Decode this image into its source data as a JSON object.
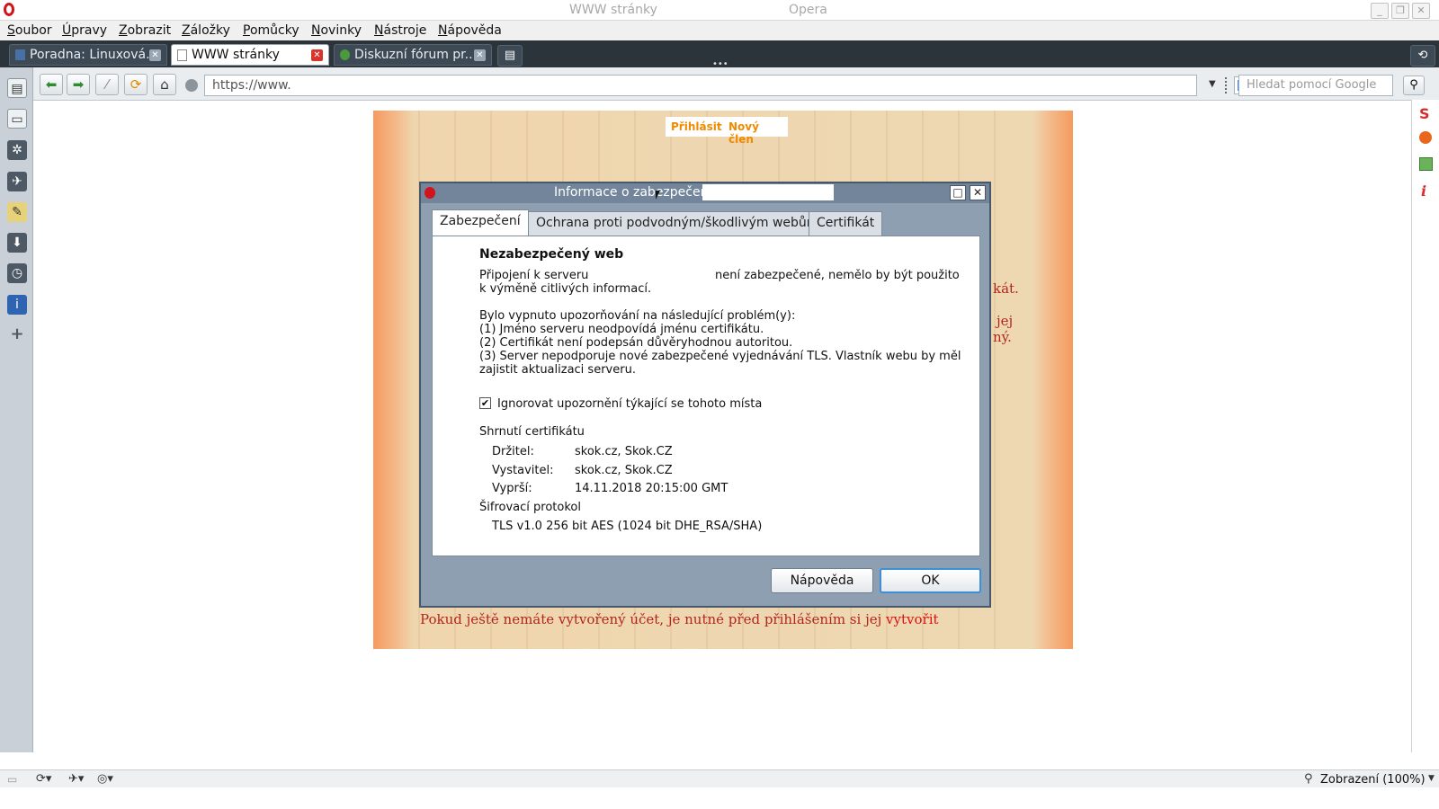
{
  "window": {
    "title_left": "WWW stránky",
    "title_right": "Opera"
  },
  "menu": [
    "Soubor",
    "Úpravy",
    "Zobrazit",
    "Záložky",
    "Pomůcky",
    "Novinky",
    "Nástroje",
    "Nápověda"
  ],
  "tabs": [
    {
      "label": "Poradna: Linuxová..."
    },
    {
      "label": "WWW stránky"
    },
    {
      "label": "Diskuzní fórum pr..."
    }
  ],
  "address": {
    "url": "https://www.",
    "search_placeholder": "Hledat pomocí Google"
  },
  "page": {
    "login_link": "Přihlásit",
    "register_link": "Nový člen",
    "peek_1": "kát.",
    "peek_2": "jej",
    "peek_3": "ný.",
    "footer_text": "Pokud ještě nemáte vytvořený účet, je nutné před přihlášením si jej",
    "footer_link": "vytvořit"
  },
  "dialog": {
    "title": "Informace o zabezpečení",
    "tabs": [
      "Zabezpečení",
      "Ochrana proti podvodným/škodlivým webům",
      "Certifikát"
    ],
    "heading": "Nezabezpečený web",
    "conn_a": "Připojení k serveru",
    "conn_b": "není zabezpečené, nemělo by být použito",
    "conn_c": "k výměně citlivých informací.",
    "warn_intro": "Bylo vypnuto upozorňování na následující problém(y):",
    "warn_1": "(1) Jméno serveru neodpovídá jménu certifikátu.",
    "warn_2": "(2) Certifikát není podepsán důvěryhodnou autoritou.",
    "warn_3a": "(3) Server nepodporuje nové zabezpečené vyjednávání TLS. Vlastník webu by měl",
    "warn_3b": "zajistit aktualizaci serveru.",
    "checkbox_label": "Ignorovat upozornění týkající se tohoto místa",
    "cert_summary": "Shrnutí certifikátu",
    "holder_label": "Držitel:",
    "holder_value": "skok.cz, Skok.CZ",
    "issuer_label": "Vystavitel:",
    "issuer_value": "skok.cz, Skok.CZ",
    "expires_label": "Vyprší:",
    "expires_value": "14.11.2018 20:15:00 GMT",
    "protocol_label": "Šifrovací protokol",
    "protocol_value": "TLS v1.0 256 bit AES (1024 bit DHE_RSA/SHA)",
    "help_button": "Nápověda",
    "ok_button": "OK"
  },
  "status": {
    "zoom": "Zobrazení (100%)"
  },
  "colors": {
    "opera_red": "#d1141b",
    "tabbar_bg": "#2b333b",
    "dialog_frame": "#8e9fb1",
    "link_orange": "#f08a00",
    "page_text_red": "#b3261e"
  }
}
